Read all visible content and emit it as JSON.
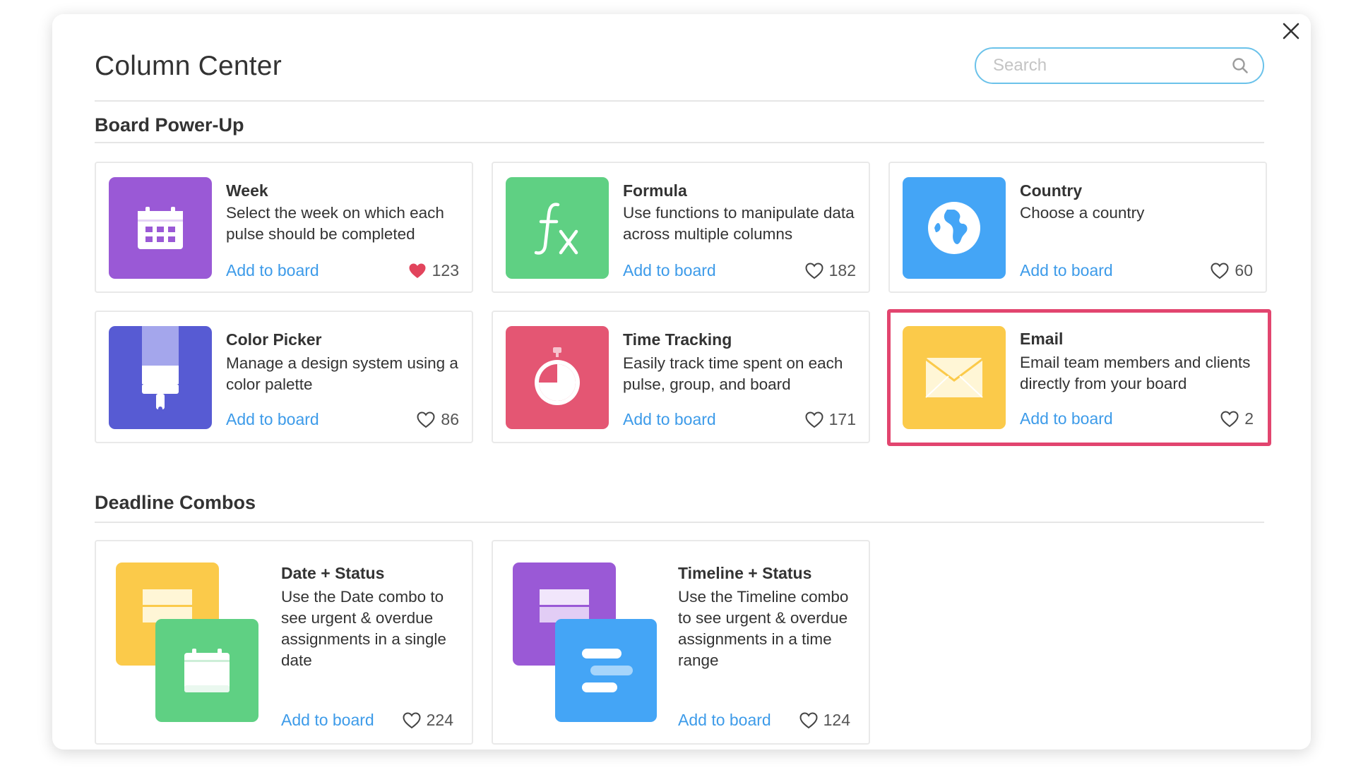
{
  "modal": {
    "title": "Column Center",
    "search": {
      "placeholder": "Search",
      "value": ""
    }
  },
  "sections": [
    {
      "title": "Board Power-Up",
      "cards": [
        {
          "name": "Week",
          "description": "Select the week on which each pulse should be completed",
          "add_label": "Add to board",
          "likes": "123",
          "liked": true,
          "icon": "calendar-icon",
          "color": "#9a59d6"
        },
        {
          "name": "Formula",
          "description": "Use functions to manipulate data across multiple columns",
          "add_label": "Add to board",
          "likes": "182",
          "liked": false,
          "icon": "formula-icon",
          "color": "#5fd083"
        },
        {
          "name": "Country",
          "description": "Choose a country",
          "add_label": "Add to board",
          "likes": "60",
          "liked": false,
          "icon": "globe-icon",
          "color": "#44a5f6"
        },
        {
          "name": "Color Picker",
          "description": "Manage a design system using a color palette",
          "add_label": "Add to board",
          "likes": "86",
          "liked": false,
          "icon": "paint-brush-icon",
          "color": "#575bd3"
        },
        {
          "name": "Time Tracking",
          "description": "Easily track time spent on each pulse, group, and board",
          "add_label": "Add to board",
          "likes": "171",
          "liked": false,
          "icon": "stopwatch-icon",
          "color": "#e45673"
        },
        {
          "name": "Email",
          "description": "Email team members and clients directly from your board",
          "add_label": "Add to board",
          "likes": "2",
          "liked": false,
          "icon": "envelope-icon",
          "color": "#fbca4a",
          "highlighted": true
        }
      ]
    },
    {
      "title": "Deadline Combos",
      "cards": [
        {
          "name": "Date + Status",
          "description": "Use the Date combo to see urgent & overdue assignments in a single date",
          "add_label": "Add to board",
          "likes": "224",
          "liked": false,
          "icon": "date-status-combo-icon",
          "colors": [
            "#fbca4a",
            "#5fd083"
          ]
        },
        {
          "name": "Timeline + Status",
          "description": "Use the Timeline combo to see urgent & overdue assignments in a time range",
          "add_label": "Add to board",
          "likes": "124",
          "liked": false,
          "icon": "timeline-status-combo-icon",
          "colors": [
            "#9a59d6",
            "#44a5f6"
          ]
        }
      ]
    }
  ],
  "colors": {
    "accent": "#3d9be9",
    "highlight": "#e2456f",
    "heart_liked": "#e2445c",
    "search_border": "#6bc2ea"
  }
}
